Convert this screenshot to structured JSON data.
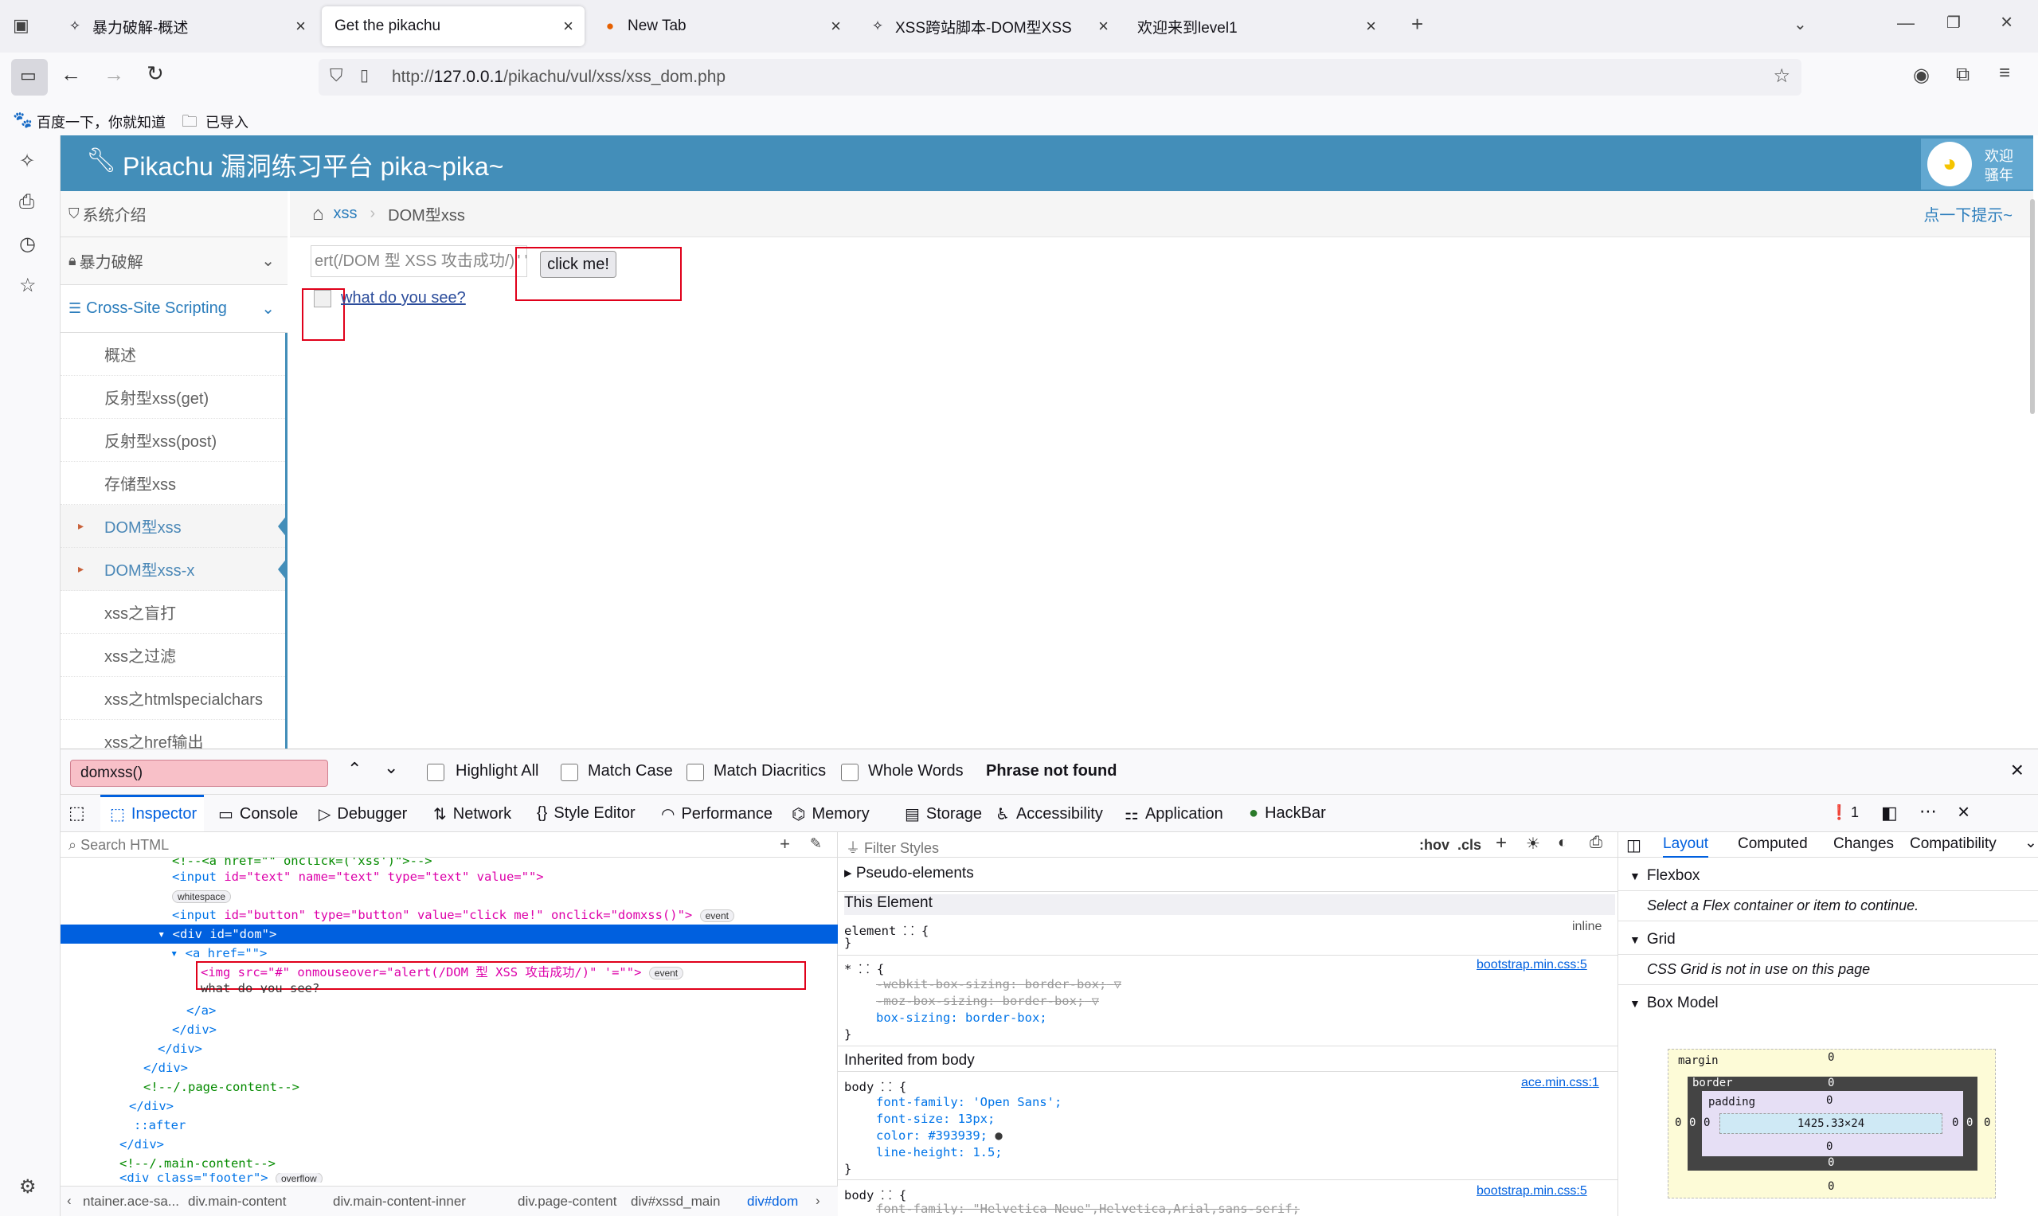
{
  "browser": {
    "tabs": [
      {
        "title": "暴力破解-概述",
        "active": false
      },
      {
        "title": "Get the pikachu",
        "active": true
      },
      {
        "title": "New Tab",
        "active": false
      },
      {
        "title": "XSS跨站脚本-DOM型XSS",
        "active": false
      },
      {
        "title": "欢迎来到level1",
        "active": false
      }
    ],
    "url_prefix": "http://",
    "url_host": "127.0.0.1",
    "url_path": "/pikachu/vul/xss/xss_dom.php",
    "bookmarks": [
      "百度一下，你就知道",
      "已导入"
    ]
  },
  "page": {
    "title": "Pikachu 漏洞练习平台 pika~pika~",
    "welcome_line1": "欢迎",
    "welcome_line2": "骚年",
    "menu_intro": "系统介绍",
    "menu_brute": "暴力破解",
    "menu_xss": "Cross-Site Scripting",
    "submenu": [
      "概述",
      "反射型xss(get)",
      "反射型xss(post)",
      "存储型xss",
      "DOM型xss",
      "DOM型xss-x",
      "xss之盲打",
      "xss之过滤",
      "xss之htmlspecialchars",
      "xss之href输出"
    ],
    "breadcrumb_link": "xss",
    "breadcrumb_current": "DOM型xss",
    "hint": "点一下提示~",
    "input_value": "ert(/DOM 型 XSS 攻击成功/)\" '=\"\"",
    "button_label": "click me!",
    "link_text": "what do you see?"
  },
  "findbar": {
    "query": "domxss()",
    "options": [
      "Highlight All",
      "Match Case",
      "Match Diacritics",
      "Whole Words"
    ],
    "status": "Phrase not found"
  },
  "devtools": {
    "tabs": [
      "Inspector",
      "Console",
      "Debugger",
      "Network",
      "Style Editor",
      "Performance",
      "Memory",
      "Storage",
      "Accessibility",
      "Application",
      "HackBar"
    ],
    "error_count": "1",
    "search_placeholder": "Search HTML",
    "filter_placeholder": "Filter Styles",
    "hov": ":hov",
    "cls": ".cls",
    "breadcrumbs": [
      "ntainer.ace-sa...",
      "div.main-content",
      "div.main-content-inner",
      "div.page-content",
      "div#xssd_main",
      "div#dom"
    ],
    "markup": {
      "l0": "<!--<a href=\"\" onclick=('xss')\">-->",
      "l1_tag": "<input",
      "l1_attrs": "id=\"text\" name=\"text\" type=\"text\" value=\"\">",
      "l1_badge": "whitespace",
      "l2_tag": "<input",
      "l2_attrs": "id=\"button\" type=\"button\" value=\"click me!\" onclick=\"domxss()\">",
      "l2_badge": "event",
      "l3": "<div id=\"dom\">",
      "l4": "<a href=\"\">",
      "l5": "<img src=\"#\" onmouseover=\"alert(/DOM 型 XSS 攻击成功/)\" '=\"\">",
      "l5_badge": "event",
      "l6": "what do you see?",
      "l7": "</a>",
      "l8": "</div>",
      "l9": "</div>",
      "l10": "</div>",
      "l11": "<!--/.page-content-->",
      "l12": "</div>",
      "l13": "::after",
      "l14": "</div>",
      "l15": "<!--/.main-content-->",
      "l16": "<div class=\"footer\">",
      "l16_badge": "overflow"
    },
    "rules": {
      "pseudo": "Pseudo-elements",
      "this_element": "This Element",
      "element_sel": "element",
      "inline": "inline",
      "star_sel": "*",
      "bootstrap1": "bootstrap.min.css:5",
      "webkit": "-webkit-box-sizing: border-box;",
      "moz": "-moz-box-sizing: border-box;",
      "box_sizing": "box-sizing: border-box;",
      "inherited": "Inherited from body",
      "body_sel": "body",
      "ace": "ace.min.css:1",
      "ff": "font-family: 'Open Sans';",
      "fs": "font-size: 13px;",
      "color": "color: #393939;",
      "lh": "line-height: 1.5;",
      "bootstrap2": "bootstrap.min.css:5",
      "ff2": "font-family: \"Helvetica Neue\",Helvetica,Arial,sans-serif;"
    },
    "layout_tabs": [
      "Layout",
      "Computed",
      "Changes",
      "Compatibility"
    ],
    "flexbox": "Flexbox",
    "flexbox_msg": "Select a Flex container or item to continue.",
    "grid": "Grid",
    "grid_msg": "CSS Grid is not in use on this page",
    "boxmodel": "Box Model",
    "bm_margin": "margin",
    "bm_border": "border",
    "bm_padding": "padding",
    "bm_content": "1425.33×24",
    "bm_zero": "0"
  },
  "colors": {
    "accent": "#438eb9",
    "devtools_blue": "#0060df",
    "highlight_red": "#e0001a"
  }
}
